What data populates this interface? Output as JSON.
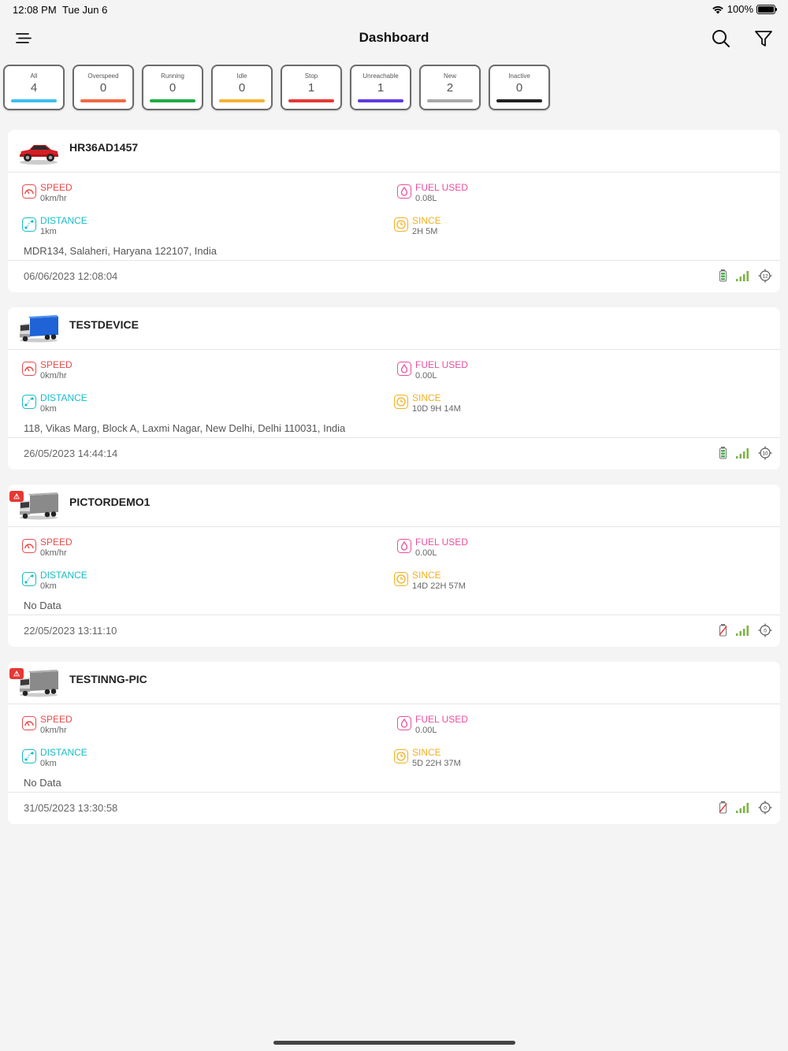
{
  "status": {
    "time": "12:08 PM",
    "date": "Tue Jun 6",
    "battery": "100%"
  },
  "nav": {
    "title": "Dashboard"
  },
  "filters": [
    {
      "label": "All",
      "count": "4",
      "color": "#3fbdf0"
    },
    {
      "label": "Overspeed",
      "count": "0",
      "color": "#f26a43"
    },
    {
      "label": "Running",
      "count": "0",
      "color": "#1fab45"
    },
    {
      "label": "Idle",
      "count": "0",
      "color": "#f5b335"
    },
    {
      "label": "Stop",
      "count": "1",
      "color": "#e53935"
    },
    {
      "label": "Unreachable",
      "count": "1",
      "color": "#5f3be0"
    },
    {
      "label": "New",
      "count": "2",
      "color": "#a9a9a9"
    },
    {
      "label": "Inactive",
      "count": "0",
      "color": "#222222"
    }
  ],
  "metric_labels": {
    "speed": "SPEED",
    "fuel": "FUEL USED",
    "distance": "DISTANCE",
    "since": "SINCE"
  },
  "colors": {
    "speed": "#e84b4b",
    "fuel": "#e94f9c",
    "distance": "#18bcc4",
    "since": "#f2b01e"
  },
  "vehicles": [
    {
      "name": "HR36AD1457",
      "type": "car",
      "alert": false,
      "speed": "0km/hr",
      "fuel": "0.08L",
      "distance": "1km",
      "since": "2H 5M",
      "address": "MDR134, Salaheri, Haryana 122107, India",
      "timestamp": "06/06/2023 12:08:04",
      "satellites": "12",
      "battery_ok": true
    },
    {
      "name": "TESTDEVICE",
      "type": "truck-blue",
      "alert": false,
      "speed": "0km/hr",
      "fuel": "0.00L",
      "distance": "0km",
      "since": "10D 9H 14M",
      "address": "118, Vikas Marg, Block A, Laxmi Nagar, New Delhi, Delhi 110031, India",
      "timestamp": "26/05/2023 14:44:14",
      "satellites": "10",
      "battery_ok": true
    },
    {
      "name": "PICTORDEMO1",
      "type": "truck-grey",
      "alert": true,
      "speed": "0km/hr",
      "fuel": "0.00L",
      "distance": "0km",
      "since": "14D 22H 57M",
      "address": "No Data",
      "timestamp": "22/05/2023 13:11:10",
      "satellites": "0",
      "battery_ok": false
    },
    {
      "name": "TESTINNG-PIC",
      "type": "truck-grey",
      "alert": true,
      "speed": "0km/hr",
      "fuel": "0.00L",
      "distance": "0km",
      "since": "5D 22H 37M",
      "address": "No Data",
      "timestamp": "31/05/2023 13:30:58",
      "satellites": "0",
      "battery_ok": false
    }
  ]
}
